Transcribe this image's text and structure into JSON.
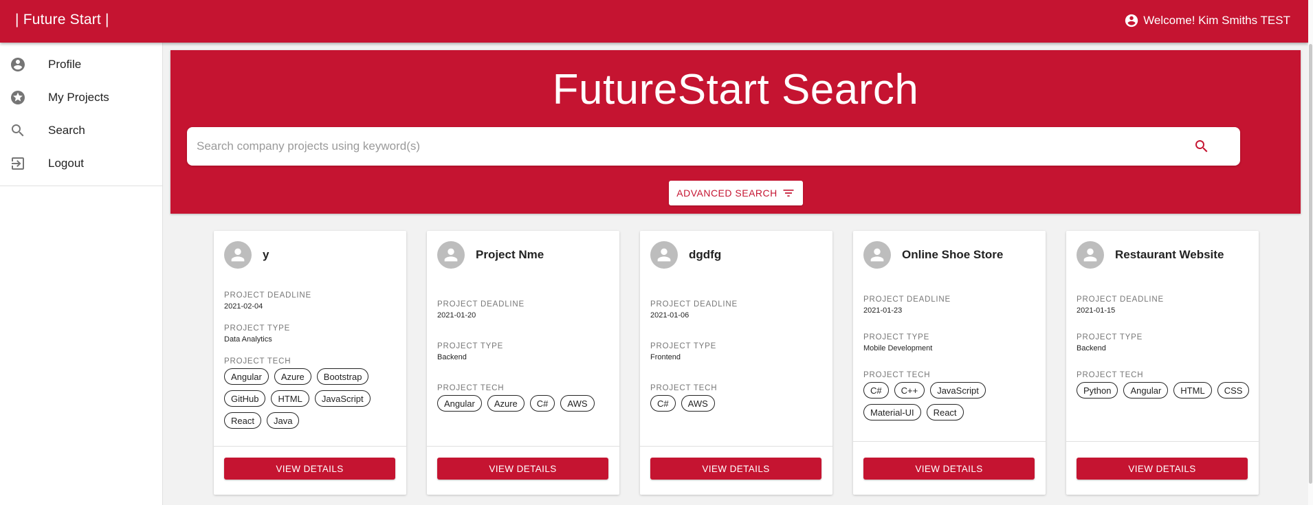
{
  "appbar": {
    "brand": "| Future Start |",
    "welcome": "Welcome! Kim Smiths TEST"
  },
  "sidebar": {
    "items": [
      {
        "label": "Profile",
        "icon": "account-circle-icon"
      },
      {
        "label": "My Projects",
        "icon": "star-icon"
      },
      {
        "label": "Search",
        "icon": "search-icon"
      },
      {
        "label": "Logout",
        "icon": "logout-icon"
      }
    ]
  },
  "hero": {
    "title": "FutureStart Search",
    "search_placeholder": "Search company projects using keyword(s)",
    "advanced_label": "ADVANCED SEARCH"
  },
  "labels": {
    "deadline": "PROJECT DEADLINE",
    "type": "PROJECT TYPE",
    "tech": "PROJECT TECH",
    "view": "VIEW DETAILS"
  },
  "cards": [
    {
      "title": "y",
      "deadline": "2021-02-04",
      "type": "Data Analytics",
      "tech": [
        "Angular",
        "Azure",
        "Bootstrap",
        "GitHub",
        "HTML",
        "JavaScript",
        "React",
        "Java"
      ]
    },
    {
      "title": "Project Nme",
      "deadline": "2021-01-20",
      "type": "Backend",
      "tech": [
        "Angular",
        "Azure",
        "C#",
        "AWS"
      ]
    },
    {
      "title": "dgdfg",
      "deadline": "2021-01-06",
      "type": "Frontend",
      "tech": [
        "C#",
        "AWS"
      ]
    },
    {
      "title": "Online Shoe Store",
      "deadline": "2021-01-23",
      "type": "Mobile Development",
      "tech": [
        "C#",
        "C++",
        "JavaScript",
        "Material-UI",
        "React"
      ]
    },
    {
      "title": "Restaurant Website",
      "deadline": "2021-01-15",
      "type": "Backend",
      "tech": [
        "Python",
        "Angular",
        "HTML",
        "CSS"
      ]
    }
  ],
  "colors": {
    "brand": "#c51431",
    "background": "#f2f2f2",
    "card": "#ffffff"
  }
}
